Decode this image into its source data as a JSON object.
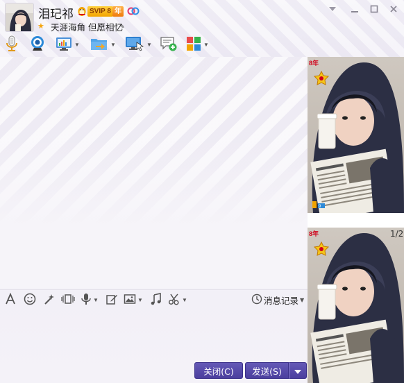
{
  "contact": {
    "name": "泪玘祁",
    "signature": "天涯海角 但愿相忆",
    "svip_label": "SVIP 8",
    "year_label": "年"
  },
  "toolbar": {
    "items": [
      {
        "icon": "microphone-icon"
      },
      {
        "icon": "webcam-icon"
      },
      {
        "icon": "screen-share-icon",
        "dropdown": true
      },
      {
        "icon": "file-transfer-icon",
        "dropdown": true
      },
      {
        "icon": "remote-desktop-icon",
        "dropdown": true
      },
      {
        "icon": "new-chat-icon"
      },
      {
        "icon": "apps-icon",
        "dropdown": true
      }
    ]
  },
  "input_toolbar": {
    "history_label": "消息记录"
  },
  "side_panel": {
    "page_indicator": "1/2",
    "badge_label": "8年"
  },
  "buttons": {
    "close": "关闭(C)",
    "send": "发送(S)"
  },
  "colors": {
    "button_bg": "#5549a8",
    "accent_gold": "#f2a400",
    "background": "#f4f2f8"
  }
}
